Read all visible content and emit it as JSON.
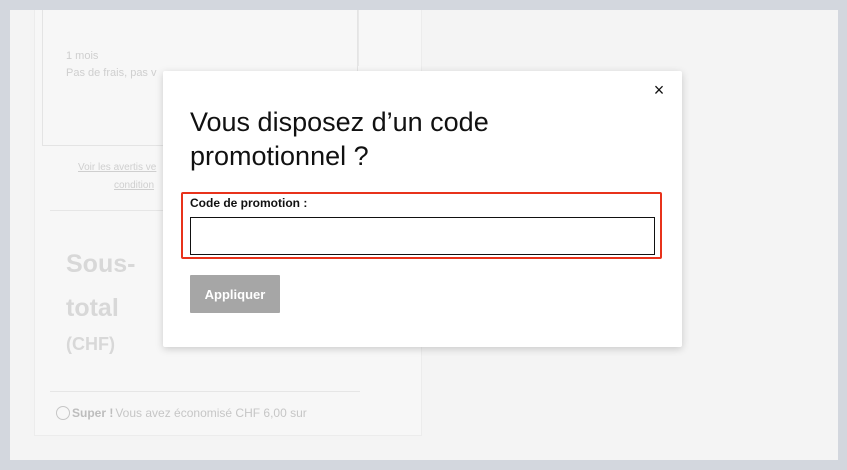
{
  "background": {
    "plan_duration": "1 mois",
    "plan_fees": "Pas de frais, pas v",
    "link_line1": "Voir les avertis ve",
    "link_line2": "condition",
    "subtotal_label": "Sous-total",
    "subtotal_currency": "(CHF)",
    "savings_strong": "Super !",
    "savings_text": "Vous avez économisé CHF 6,00 sur"
  },
  "modal": {
    "close_symbol": "×",
    "title": "Vous disposez d’un code promotionnel ?",
    "field_label": "Code de promotion :",
    "input_value": "",
    "input_placeholder": "",
    "apply_label": "Appliquer"
  },
  "colors": {
    "highlight": "#e8321b",
    "apply_button": "#a6a6a6",
    "backdrop": "#d3d7de"
  }
}
